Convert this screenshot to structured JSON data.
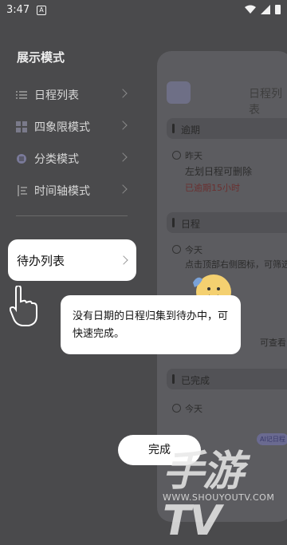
{
  "status_bar": {
    "time": "3:47",
    "notif_icon_letter": "A"
  },
  "drawer": {
    "title": "展示模式",
    "items": [
      {
        "label": "日程列表",
        "icon": "list-icon"
      },
      {
        "label": "四象限模式",
        "icon": "quadrant-icon"
      },
      {
        "label": "分类模式",
        "icon": "category-icon"
      },
      {
        "label": "时间轴模式",
        "icon": "timeline-icon"
      }
    ]
  },
  "highlight_item": {
    "label": "待办列表"
  },
  "tooltip": {
    "text": "没有日期的日程归集到待办中，可快速完成。"
  },
  "done_button": {
    "label": "完成"
  },
  "background": {
    "title": "日程列表",
    "sections": [
      {
        "label": "逾期"
      },
      {
        "label": "日程"
      },
      {
        "label": "已完成"
      }
    ],
    "overdue_item": {
      "date": "昨天",
      "title": "左划日程可删除",
      "status": "已逾期15小时"
    },
    "schedule_item": {
      "date": "今天",
      "title": "点击顶部右侧图标，可筛选"
    },
    "todo_item": {
      "text": "可查看"
    },
    "done_item": {
      "date": "今天"
    },
    "badge": "AI记日程"
  },
  "watermark": {
    "big": "手游TV",
    "small": "WWW.SHOUYOUTV.COM"
  }
}
